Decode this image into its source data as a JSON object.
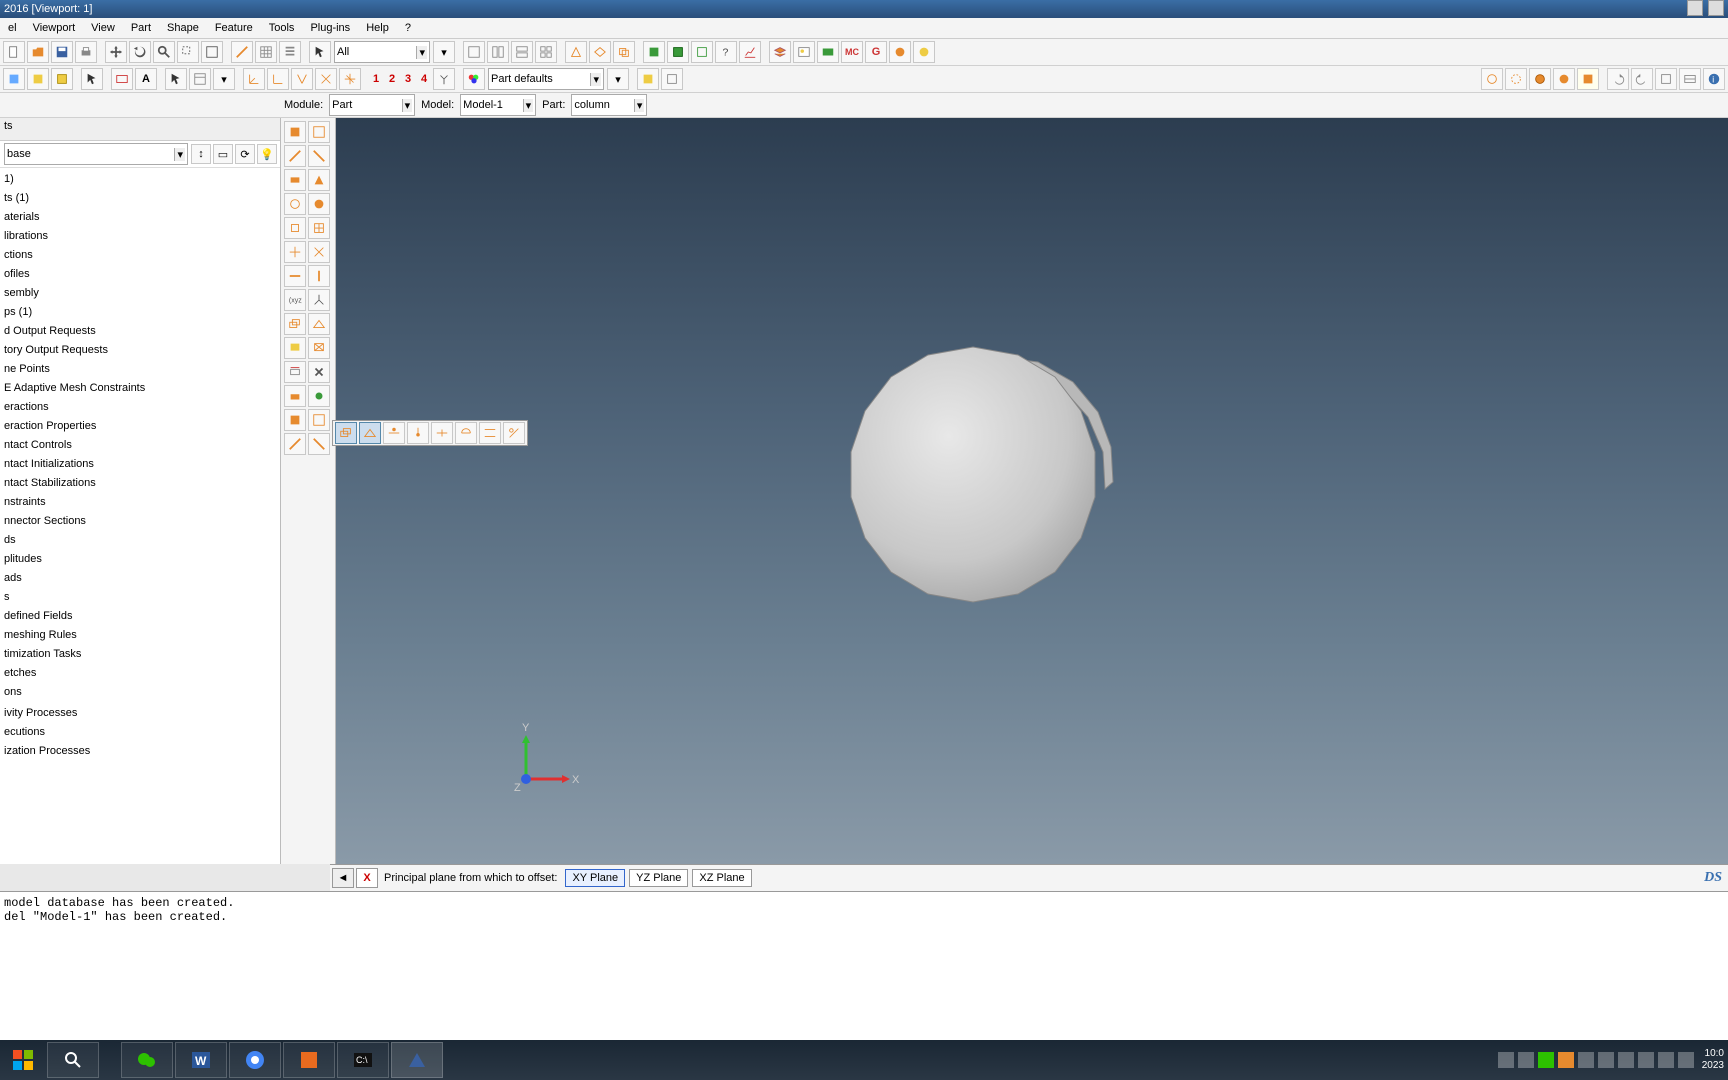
{
  "titlebar": {
    "text": "2016 [Viewport: 1]"
  },
  "menus": [
    "el",
    "Viewport",
    "View",
    "Part",
    "Shape",
    "Feature",
    "Tools",
    "Plug-ins",
    "Help",
    "?"
  ],
  "toolbar1": {
    "all_label": "All",
    "part_defaults": "Part defaults"
  },
  "contextbar": {
    "module_label": "Module:",
    "module_value": "Part",
    "model_label": "Model:",
    "model_value": "Model-1",
    "part_label": "Part:",
    "part_value": "column"
  },
  "tree": {
    "header": "ts",
    "root": "base",
    "items": [
      "1)",
      "ts (1)",
      "aterials",
      "librations",
      "ctions",
      "ofiles",
      "sembly",
      "ps (1)",
      "d Output Requests",
      "tory Output Requests",
      "ne Points",
      "E Adaptive Mesh Constraints",
      "eractions",
      "eraction Properties",
      "ntact Controls",
      "ntact Initializations",
      "ntact Stabilizations",
      "nstraints",
      "nnector Sections",
      "ds",
      "plitudes",
      "ads",
      "s",
      "defined Fields",
      "meshing Rules",
      "timization Tasks",
      "etches",
      "ons",
      "",
      "ivity Processes",
      "ecutions",
      "ization Processes"
    ]
  },
  "numbers": [
    "1",
    "2",
    "3",
    "4"
  ],
  "prompt": {
    "text": "Principal plane from which to offset:",
    "buttons": [
      "XY Plane",
      "YZ Plane",
      "XZ Plane"
    ],
    "selected": 0
  },
  "messages": "model database has been created.\ndel \"Model-1\" has been created.",
  "triad": {
    "x": "X",
    "y": "Y",
    "z": "Z"
  },
  "clock": {
    "time": "10:0",
    "date": "2023"
  }
}
